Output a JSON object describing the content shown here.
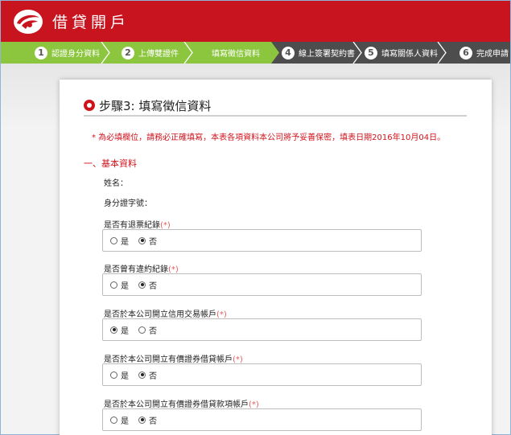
{
  "header": {
    "brand": "借貸開戶"
  },
  "steps": [
    {
      "num": "1",
      "label": "認證身分資料"
    },
    {
      "num": "2",
      "label": "上傳雙證件"
    },
    {
      "num": "",
      "label": "填寫徵信資料"
    },
    {
      "num": "4",
      "label": "線上簽署契約書"
    },
    {
      "num": "5",
      "label": "填寫關係人資料"
    },
    {
      "num": "6",
      "label": "完成申請"
    }
  ],
  "page": {
    "title": "步驟3: 填寫徵信資料",
    "notice": "* 為必填欄位，請務必正確填寫，本表各項資料本公司將予妥善保密，填表日期2016年10月04日。",
    "section": "一、基本資料",
    "name_label": "姓名：",
    "id_label": "身分證字號："
  },
  "questions": [
    {
      "label": "是否有退票紀錄",
      "required": "(*)",
      "yes": "是",
      "no": "否",
      "selected": "no"
    },
    {
      "label": "是否曾有違約紀錄",
      "required": "(*)",
      "yes": "是",
      "no": "否",
      "selected": "no"
    },
    {
      "label": "是否於本公司開立信用交易帳戶",
      "required": "(*)",
      "yes": "是",
      "no": "否",
      "selected": "yes"
    },
    {
      "label": "是否於本公司開立有價證券借貸帳戶",
      "required": "(*)",
      "yes": "是",
      "no": "否",
      "selected": "no"
    },
    {
      "label": "是否於本公司開立有價證券借貸款項帳戶",
      "required": "(*)",
      "yes": "是",
      "no": "否",
      "selected": "no"
    }
  ],
  "colors": {
    "brand_red": "#c8141e",
    "step_green": "#8cc63f",
    "step_dark": "#4d4d4d"
  }
}
